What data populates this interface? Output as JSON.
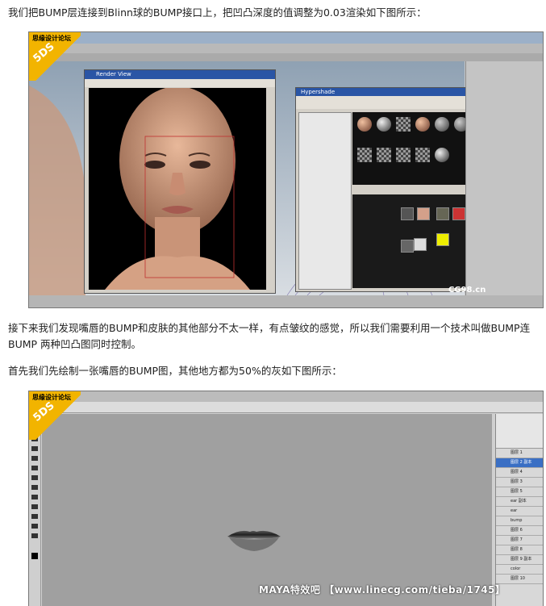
{
  "paragraphs": {
    "p1": "我们把BUMP层连接到Blinn球的BUMP接口上，把凹凸深度的值调整为0.03渲染如下图所示：",
    "p2": "接下来我们发现嘴唇的BUMP和皮肤的其他部分不太一样，有点皱纹的感觉，所以我们需要利用一个技术叫做BUMP连BUMP 两种凹凸图同时控制。",
    "p3": "首先我们先绘制一张嘴唇的BUMP图，其他地方都为50%的灰如下图所示："
  },
  "screenshot1": {
    "watermark_site": "思缘设计论坛",
    "watermark_logo": "5DS",
    "render_view_title": "Render View",
    "hypershade_title": "Hypershade",
    "cg_watermark": "CG98.cn",
    "colors": {
      "accent": "#f2b400",
      "titlebar": "#2a55a5"
    }
  },
  "screenshot2": {
    "watermark_site": "思缘设计论坛",
    "watermark_logo": "5DS",
    "caption": "MAYA特效吧 【www.linecg.com/tieba/1745】",
    "layers": [
      "图层 1",
      "图层 2 副本",
      "图层 4",
      "图层 3",
      "图层 5",
      "ear 副本",
      "ear",
      "bump",
      "图层 6",
      "图层 7",
      "图层 8",
      "图层 9 副本",
      "color",
      "图层 10"
    ]
  }
}
